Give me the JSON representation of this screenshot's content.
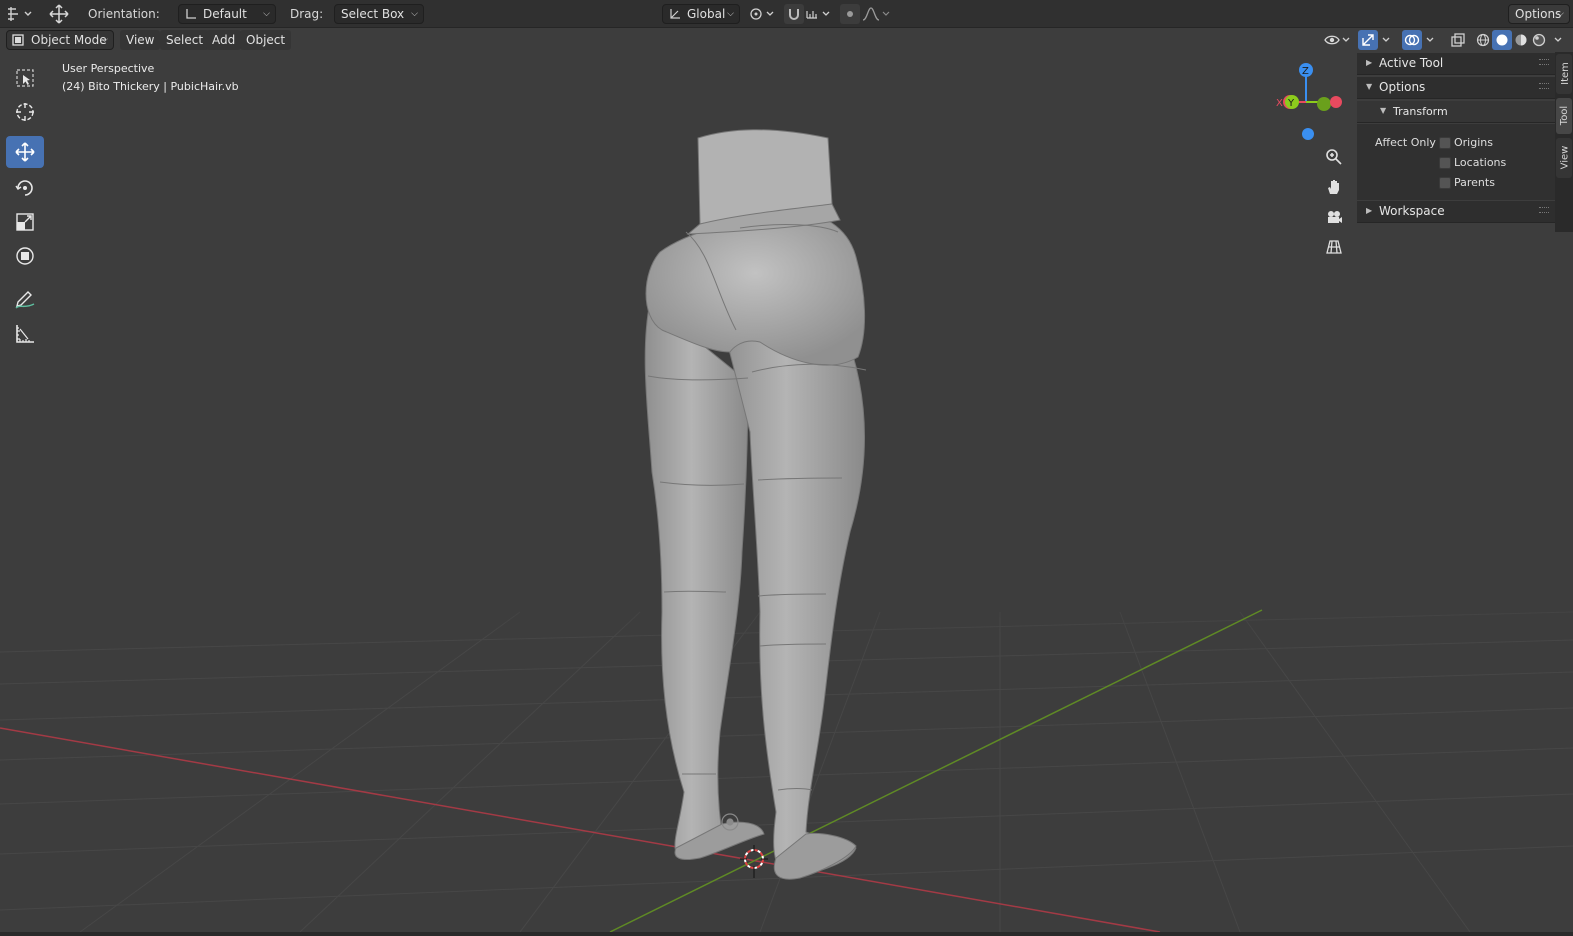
{
  "header": {
    "orientation_label": "Orientation:",
    "orientation_value": "Default",
    "drag_label": "Drag:",
    "drag_value": "Select Box",
    "transform_orientation": "Global",
    "options_label": "Options"
  },
  "menu": {
    "mode": "Object Mode",
    "items": [
      "View",
      "Select",
      "Add",
      "Object"
    ]
  },
  "viewport": {
    "perspective": "User Perspective",
    "object_info": "(24) Bito Thickery | PubicHair.vb",
    "gizmo_axes": {
      "z": "Z",
      "y": "Y",
      "x": "X"
    }
  },
  "sidebar": {
    "sections": {
      "active_tool": "Active Tool",
      "options": "Options",
      "transform": "Transform",
      "workspace": "Workspace"
    },
    "affect_only_label": "Affect Only",
    "affect_only": [
      {
        "label": "Origins",
        "checked": false
      },
      {
        "label": "Locations",
        "checked": false
      },
      {
        "label": "Parents",
        "checked": false
      }
    ],
    "tabs": [
      "Item",
      "Tool",
      "View"
    ],
    "active_tab": "Tool"
  },
  "colors": {
    "accent": "#4772b3",
    "x_axis": "#e84a5f",
    "y_axis": "#8ccc1c",
    "z_axis": "#3a8ff0"
  }
}
